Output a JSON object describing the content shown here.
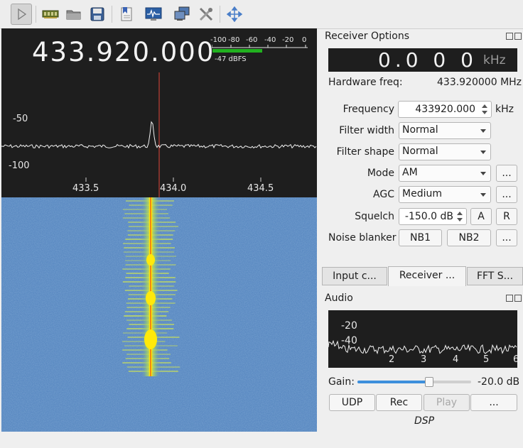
{
  "toolbar": {
    "icons": [
      "play-icon",
      "hardware-icon",
      "open-folder-icon",
      "save-icon",
      "bookmark-icon",
      "monitor-icon",
      "network-icon",
      "settings-tools-icon",
      "center-fft-icon"
    ]
  },
  "display": {
    "frequency": "433.920.000",
    "dbfs_ticks": [
      "-100",
      "-80",
      "-60",
      "-40",
      "-20",
      "0"
    ],
    "dbfs_level_text": "-47 dBFS",
    "dbfs_level_value": -47,
    "y_axis_labels": [
      "-50",
      "-100"
    ],
    "x_axis_labels": [
      "433.5",
      "434.0",
      "434.5"
    ]
  },
  "receiver": {
    "title": "Receiver Options",
    "offset_readout": "0.0 0 0",
    "offset_unit": "kHz",
    "hw_freq_label": "Hardware freq:",
    "hw_freq_value": "433.920000 MHz",
    "frequency_label": "Frequency",
    "frequency_value": "433920.000",
    "frequency_unit": "kHz",
    "filter_width_label": "Filter width",
    "filter_width_value": "Normal",
    "filter_shape_label": "Filter shape",
    "filter_shape_value": "Normal",
    "mode_label": "Mode",
    "mode_value": "AM",
    "agc_label": "AGC",
    "agc_value": "Medium",
    "squelch_label": "Squelch",
    "squelch_value": "-150.0 dB",
    "squelch_a": "A",
    "squelch_r": "R",
    "noise_blanker_label": "Noise blanker",
    "nb1": "NB1",
    "nb2": "NB2",
    "more": "..."
  },
  "tabs": [
    "Input c...",
    "Receiver ...",
    "FFT S..."
  ],
  "audio": {
    "title": "Audio",
    "y_labels": [
      "-20",
      "-40"
    ],
    "x_labels": [
      "2",
      "3",
      "4",
      "5",
      "6"
    ],
    "gain_label": "Gain:",
    "gain_value": "-20.0 dB",
    "gain_level": 0.63,
    "udp": "UDP",
    "rec": "Rec",
    "play": "Play",
    "more": "...",
    "dsp": "DSP"
  },
  "colors": {
    "plot_bg": "#1e1e1e",
    "marker": "#e0473a",
    "meter_fill": "#21b11f",
    "waterfall_bg": "#5b8ac2",
    "signal": "#ffe90a"
  }
}
